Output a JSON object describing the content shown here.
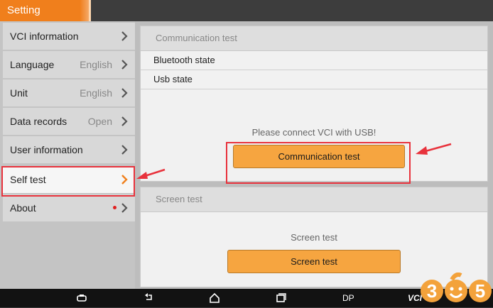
{
  "header": {
    "title": "Setting"
  },
  "sidebar": {
    "items": [
      {
        "label": "VCI information",
        "value": ""
      },
      {
        "label": "Language",
        "value": "English"
      },
      {
        "label": "Unit",
        "value": "English"
      },
      {
        "label": "Data records",
        "value": "Open"
      },
      {
        "label": "User information",
        "value": ""
      },
      {
        "label": "Self test",
        "value": ""
      },
      {
        "label": "About",
        "value": ""
      }
    ],
    "selected_index": 5
  },
  "communication_panel": {
    "title": "Communication test",
    "rows": [
      "Bluetooth state",
      "Usb state"
    ],
    "hint": "Please connect VCI with USB!",
    "button_label": "Communication test"
  },
  "screen_panel": {
    "title": "Screen test",
    "hint": "Screen test",
    "button_label": "Screen test"
  },
  "navbar": {
    "icons": [
      "screenshot-icon",
      "back-icon",
      "home-icon",
      "recent-apps-icon"
    ],
    "dp_label": "DP",
    "vci_label": "VCI"
  },
  "watermark": {
    "text": "365"
  },
  "colors": {
    "accent": "#f07f1c",
    "button": "#f6a540",
    "highlight": "#e8323c"
  }
}
